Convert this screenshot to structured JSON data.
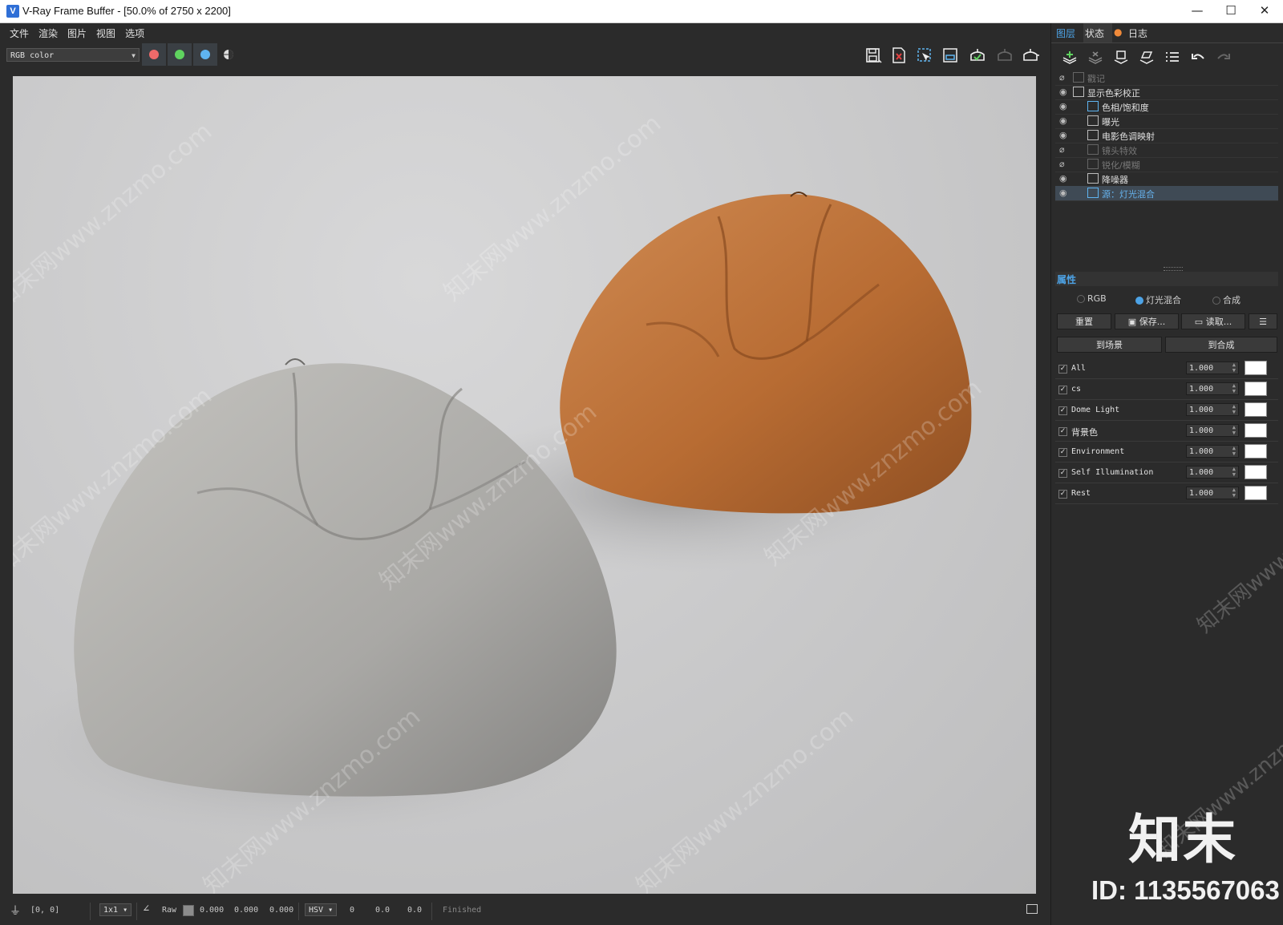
{
  "window": {
    "title": "V-Ray Frame Buffer - [50.0% of 2750 x 2200]",
    "app_icon": "vray-logo-icon",
    "controls": {
      "minimize": "—",
      "maximize": "☐",
      "close": "✕"
    }
  },
  "menu": [
    "文件",
    "渲染",
    "图片",
    "视图",
    "选项"
  ],
  "toolbar": {
    "channel": "RGB color",
    "channel_buttons": [
      {
        "name": "red",
        "color": "#ee6a6a"
      },
      {
        "name": "green",
        "color": "#5fd35f"
      },
      {
        "name": "blue",
        "color": "#5fb4f0"
      }
    ],
    "icons": [
      "save-image-icon",
      "clear-image-icon",
      "region-render-icon",
      "track-mouse-icon",
      "render-interactive-icon",
      "render-disabled-icon",
      "render-teapot-icon"
    ]
  },
  "watermark": {
    "text": "知末网www.znzmo.com"
  },
  "statusbar": {
    "coords": "[0, 0]",
    "zoom": "1x1",
    "raw_label": "Raw",
    "rgb_values": [
      "0.000",
      "0.000",
      "0.000"
    ],
    "color_mode": "HSV",
    "hsv_values": [
      "0",
      "0.0",
      "0.0"
    ],
    "status": "Finished"
  },
  "right_panel": {
    "tabs": [
      {
        "label": "图层",
        "active": true
      },
      {
        "label": "状态",
        "active": false
      },
      {
        "label": "日志",
        "active": false
      }
    ],
    "layer_icons": [
      "add-layer-icon",
      "delete-layer-icon",
      "save-layers-icon",
      "load-layers-icon",
      "layer-list-icon",
      "undo-icon",
      "redo-icon"
    ],
    "layers": [
      {
        "label": "戳记",
        "visible": false,
        "indent": 0,
        "dim": true
      },
      {
        "label": "显示色彩校正",
        "visible": true,
        "indent": 0,
        "dim": false
      },
      {
        "label": "色相/饱和度",
        "visible": true,
        "indent": 1,
        "dim": false
      },
      {
        "label": "曝光",
        "visible": true,
        "indent": 1,
        "dim": false
      },
      {
        "label": "电影色调映射",
        "visible": true,
        "indent": 1,
        "dim": false
      },
      {
        "label": "镜头特效",
        "visible": false,
        "indent": 1,
        "dim": true
      },
      {
        "label": "锐化/模糊",
        "visible": false,
        "indent": 1,
        "dim": true
      },
      {
        "label": "降噪器",
        "visible": true,
        "indent": 1,
        "dim": false
      },
      {
        "label": "源：灯光混合",
        "visible": true,
        "indent": 1,
        "dim": false,
        "selected": true
      }
    ],
    "properties": {
      "title": "属性",
      "modes": [
        {
          "label": "RGB",
          "on": false
        },
        {
          "label": "灯光混合",
          "on": true
        },
        {
          "label": "合成",
          "on": false
        }
      ],
      "buttons": {
        "reset": "重置",
        "save": "保存...",
        "load": "读取...",
        "to_scene": "到场景",
        "to_composite": "到合成"
      },
      "light_mix": [
        {
          "name": "All",
          "value": "1.000"
        },
        {
          "name": "cs",
          "value": "1.000"
        },
        {
          "name": "Dome Light",
          "value": "1.000"
        },
        {
          "name": "背景色",
          "value": "1.000"
        },
        {
          "name": "Environment",
          "value": "1.000"
        },
        {
          "name": "Self Illumination",
          "value": "1.000"
        },
        {
          "name": "Rest",
          "value": "1.000"
        }
      ]
    },
    "brand_logo": "知末",
    "brand_id": "ID: 1135567063"
  },
  "colors": {
    "accent": "#4da3e6",
    "panel_bg": "#2b2b2b",
    "leather": "#b86c33",
    "fabric": "#a9a8a5"
  }
}
